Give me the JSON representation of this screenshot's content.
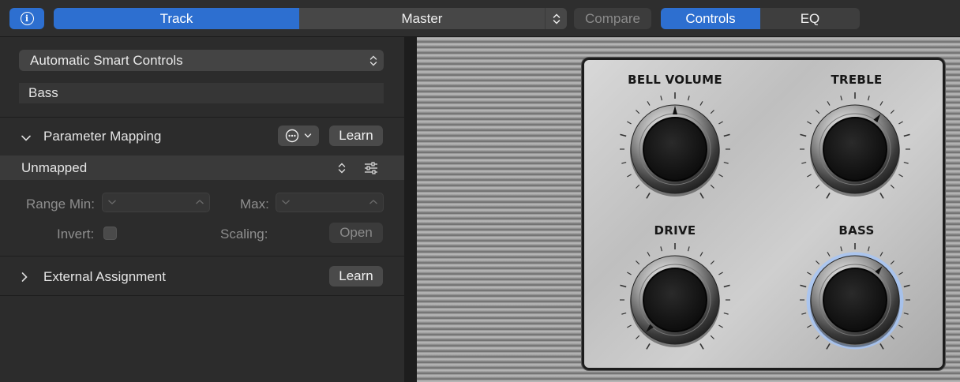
{
  "header": {
    "info_icon": "info-icon",
    "tabs": [
      {
        "label": "Track",
        "selected": true
      },
      {
        "label": "Master",
        "selected": false
      }
    ],
    "compare_label": "Compare",
    "view_tabs": [
      {
        "label": "Controls",
        "selected": true
      },
      {
        "label": "EQ",
        "selected": false
      }
    ],
    "accent_color": "#2d6fd0"
  },
  "inspector": {
    "smart_controls_dropdown": "Automatic Smart Controls",
    "patch_name": "Bass",
    "parameter_mapping": {
      "label": "Parameter Mapping",
      "expanded": true,
      "learn_label": "Learn",
      "mapping_value": "Unmapped",
      "range_min_label": "Range Min:",
      "max_label": "Max:",
      "invert_label": "Invert:",
      "invert_checked": false,
      "scaling_label": "Scaling:",
      "open_label": "Open"
    },
    "external_assignment": {
      "label": "External Assignment",
      "expanded": false,
      "learn_label": "Learn"
    }
  },
  "controls_panel": {
    "knobs": [
      {
        "label": "BELL VOLUME",
        "value": 0.5,
        "highlighted": false
      },
      {
        "label": "TREBLE",
        "value": 0.62,
        "highlighted": false
      },
      {
        "label": "DRIVE",
        "value": 0.04,
        "highlighted": false
      },
      {
        "label": "BASS",
        "value": 0.63,
        "highlighted": true
      }
    ]
  }
}
